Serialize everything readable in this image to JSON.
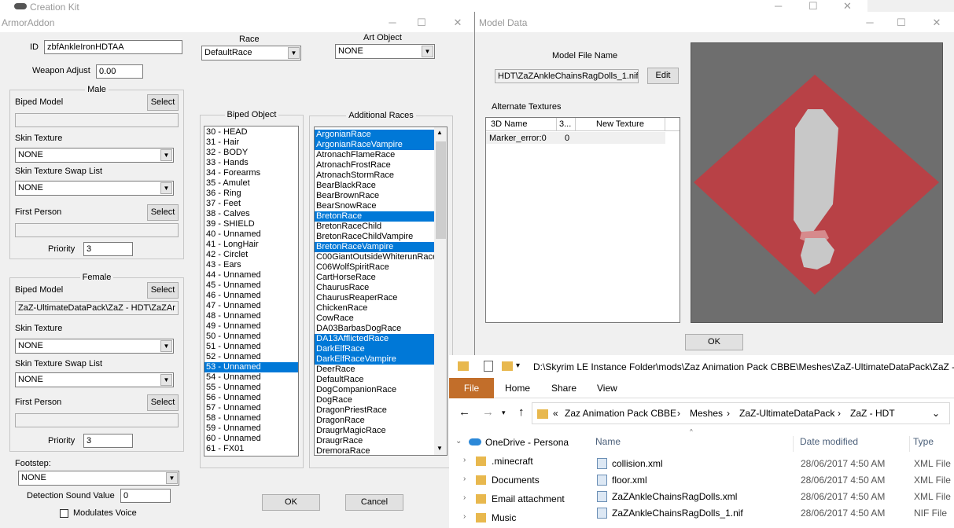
{
  "ck_title": "Creation Kit",
  "armor": {
    "title": "ArmorAddon",
    "id_label": "ID",
    "id_value": "zbfAnkleIronHDTAA",
    "weapon_adjust_label": "Weapon Adjust",
    "weapon_adjust_value": "0.00",
    "race_label": "Race",
    "race_value": "DefaultRace",
    "art_object_label": "Art Object",
    "art_object_value": "NONE",
    "male": {
      "title": "Male",
      "biped_model_label": "Biped Model",
      "select": "Select",
      "biped_model_value": "",
      "skin_texture_label": "Skin Texture",
      "skin_texture_value": "NONE",
      "swap_label": "Skin Texture Swap List",
      "swap_value": "NONE",
      "first_person_label": "First Person",
      "first_person_value": "",
      "priority_label": "Priority",
      "priority_value": "3"
    },
    "female": {
      "title": "Female",
      "biped_model_label": "Biped Model",
      "select": "Select",
      "biped_model_value": "ZaZ-UltimateDataPack\\ZaZ - HDT\\ZaZAr",
      "skin_texture_label": "Skin Texture",
      "skin_texture_value": "NONE",
      "swap_label": "Skin Texture Swap List",
      "swap_value": "NONE",
      "first_person_label": "First Person",
      "first_person_value": "",
      "priority_label": "Priority",
      "priority_value": "3"
    },
    "footstep_label": "Footstep:",
    "footstep_value": "NONE",
    "detection_label": "Detection Sound Value",
    "detection_value": "0",
    "modulates_label": "Modulates Voice",
    "biped_object_title": "Biped Object",
    "biped_objects": [
      {
        "label": "30 - HEAD",
        "sel": false
      },
      {
        "label": "31 - Hair",
        "sel": false
      },
      {
        "label": "32 - BODY",
        "sel": false
      },
      {
        "label": "33 - Hands",
        "sel": false
      },
      {
        "label": "34 - Forearms",
        "sel": false
      },
      {
        "label": "35 - Amulet",
        "sel": false
      },
      {
        "label": "36 - Ring",
        "sel": false
      },
      {
        "label": "37 - Feet",
        "sel": false
      },
      {
        "label": "38 - Calves",
        "sel": false
      },
      {
        "label": "39 - SHIELD",
        "sel": false
      },
      {
        "label": "40 - Unnamed",
        "sel": false
      },
      {
        "label": "41 - LongHair",
        "sel": false
      },
      {
        "label": "42 - Circlet",
        "sel": false
      },
      {
        "label": "43 - Ears",
        "sel": false
      },
      {
        "label": "44 - Unnamed",
        "sel": false
      },
      {
        "label": "45 - Unnamed",
        "sel": false
      },
      {
        "label": "46 - Unnamed",
        "sel": false
      },
      {
        "label": "47 - Unnamed",
        "sel": false
      },
      {
        "label": "48 - Unnamed",
        "sel": false
      },
      {
        "label": "49 - Unnamed",
        "sel": false
      },
      {
        "label": "50 - Unnamed",
        "sel": false
      },
      {
        "label": "51 - Unnamed",
        "sel": false
      },
      {
        "label": "52 - Unnamed",
        "sel": false
      },
      {
        "label": "53 - Unnamed",
        "sel": true
      },
      {
        "label": "54 - Unnamed",
        "sel": false
      },
      {
        "label": "55 - Unnamed",
        "sel": false
      },
      {
        "label": "56 - Unnamed",
        "sel": false
      },
      {
        "label": "57 - Unnamed",
        "sel": false
      },
      {
        "label": "58 - Unnamed",
        "sel": false
      },
      {
        "label": "59 - Unnamed",
        "sel": false
      },
      {
        "label": "60 - Unnamed",
        "sel": false
      },
      {
        "label": "61 - FX01",
        "sel": false
      }
    ],
    "additional_races_title": "Additional Races",
    "races": [
      {
        "label": "ArgonianRace",
        "sel": true
      },
      {
        "label": "ArgonianRaceVampire",
        "sel": true
      },
      {
        "label": "AtronachFlameRace",
        "sel": false
      },
      {
        "label": "AtronachFrostRace",
        "sel": false
      },
      {
        "label": "AtronachStormRace",
        "sel": false
      },
      {
        "label": "BearBlackRace",
        "sel": false
      },
      {
        "label": "BearBrownRace",
        "sel": false
      },
      {
        "label": "BearSnowRace",
        "sel": false
      },
      {
        "label": "BretonRace",
        "sel": true
      },
      {
        "label": "BretonRaceChild",
        "sel": false
      },
      {
        "label": "BretonRaceChildVampire",
        "sel": false
      },
      {
        "label": "BretonRaceVampire",
        "sel": true
      },
      {
        "label": "C00GiantOutsideWhiterunRace",
        "sel": false
      },
      {
        "label": "C06WolfSpiritRace",
        "sel": false
      },
      {
        "label": "CartHorseRace",
        "sel": false
      },
      {
        "label": "ChaurusRace",
        "sel": false
      },
      {
        "label": "ChaurusReaperRace",
        "sel": false
      },
      {
        "label": "ChickenRace",
        "sel": false
      },
      {
        "label": "CowRace",
        "sel": false
      },
      {
        "label": "DA03BarbasDogRace",
        "sel": false
      },
      {
        "label": "DA13AfflictedRace",
        "sel": true
      },
      {
        "label": "DarkElfRace",
        "sel": true
      },
      {
        "label": "DarkElfRaceVampire",
        "sel": true
      },
      {
        "label": "DeerRace",
        "sel": false
      },
      {
        "label": "DefaultRace",
        "sel": false
      },
      {
        "label": "DogCompanionRace",
        "sel": false
      },
      {
        "label": "DogRace",
        "sel": false
      },
      {
        "label": "DragonPriestRace",
        "sel": false
      },
      {
        "label": "DragonRace",
        "sel": false
      },
      {
        "label": "DraugrMagicRace",
        "sel": false
      },
      {
        "label": "DraugrRace",
        "sel": false
      },
      {
        "label": "DremoraRace",
        "sel": false
      }
    ],
    "ok": "OK",
    "cancel": "Cancel"
  },
  "model": {
    "title": "Model Data",
    "file_name_label": "Model File Name",
    "file_name_value": "HDT\\ZaZAnkleChainsRagDolls_1.nif",
    "edit": "Edit",
    "alt_tex_label": "Alternate Textures",
    "columns": [
      "3D Name",
      "3...",
      "New Texture"
    ],
    "rows": [
      [
        "Marker_error:0",
        "0",
        ""
      ]
    ],
    "ok": "OK"
  },
  "explorer": {
    "path": "D:\\Skyrim LE Instance Folder\\mods\\Zaz Animation Pack CBBE\\Meshes\\ZaZ-UltimateDataPack\\ZaZ -",
    "tabs": [
      "File",
      "Home",
      "Share",
      "View"
    ],
    "crumbs": [
      "Zaz Animation Pack CBBE",
      "Meshes",
      "ZaZ-UltimateDataPack",
      "ZaZ - HDT"
    ],
    "crumb_prefix": "«",
    "nav": [
      "OneDrive - Persona",
      ".minecraft",
      "Documents",
      "Email attachment",
      "Music"
    ],
    "col_name": "Name",
    "col_date": "Date modified",
    "col_type": "Type",
    "files": [
      {
        "name": "collision.xml",
        "date": "28/06/2017 4:50 AM",
        "type": "XML File"
      },
      {
        "name": "floor.xml",
        "date": "28/06/2017 4:50 AM",
        "type": "XML File"
      },
      {
        "name": "ZaZAnkleChainsRagDolls.xml",
        "date": "28/06/2017 4:50 AM",
        "type": "XML File"
      },
      {
        "name": "ZaZAnkleChainsRagDolls_1.nif",
        "date": "28/06/2017 4:50 AM",
        "type": "NIF File"
      }
    ]
  }
}
